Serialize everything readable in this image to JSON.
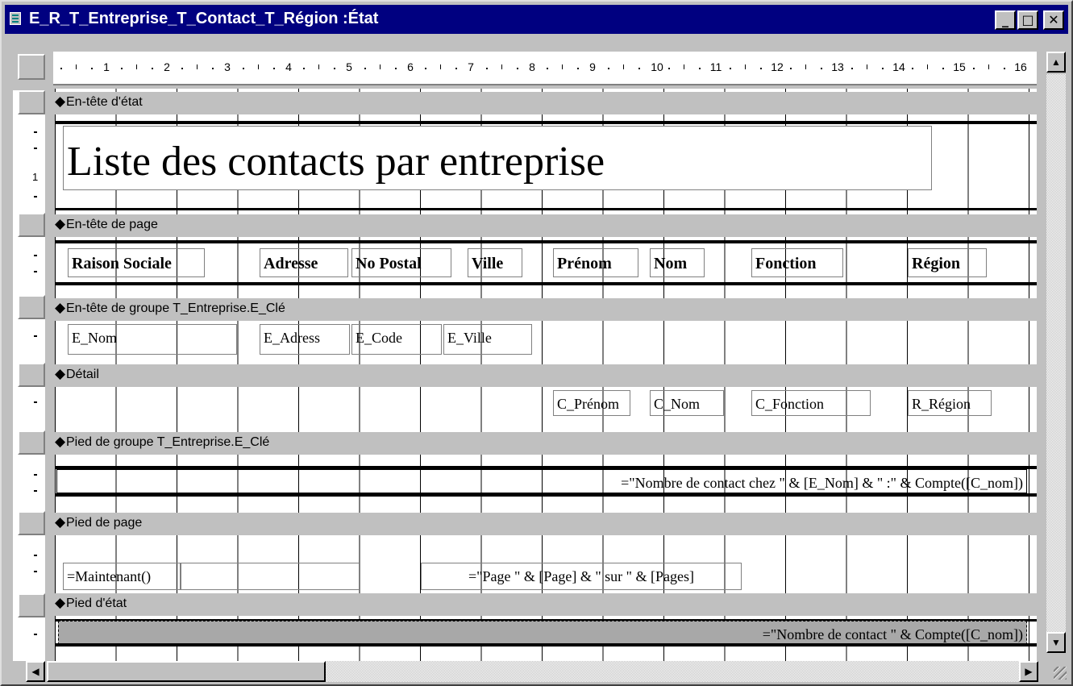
{
  "window": {
    "title": "E_R_T_Entreprise_T_Contact_T_Région :État",
    "minimize": "_",
    "maximize": "□",
    "close": "✕"
  },
  "ruler": {
    "numbers": [
      "1",
      "2",
      "3",
      "4",
      "5",
      "6",
      "7",
      "8",
      "9",
      "10",
      "11",
      "12",
      "13",
      "14",
      "15",
      "16"
    ],
    "vertical_number": "1"
  },
  "sections": {
    "report_header": "En-tête d'état",
    "page_header": "En-tête de page",
    "group_header": "En-tête de groupe T_Entreprise.E_Clé",
    "detail": "Détail",
    "group_footer": "Pied de groupe T_Entreprise.E_Clé",
    "page_footer": "Pied de page",
    "report_footer": "Pied d'état"
  },
  "report_title": "Liste des contacts par entreprise",
  "page_header_labels": {
    "raison_sociale": "Raison Sociale",
    "adresse": "Adresse",
    "no_postal": "No Postal",
    "ville": "Ville",
    "prenom": "Prénom",
    "nom": "Nom",
    "fonction": "Fonction",
    "region": "Région"
  },
  "group_fields": {
    "e_nom": "E_Nom",
    "e_adresse": "E_Adress",
    "e_code": "E_Code",
    "e_ville": "E_Ville"
  },
  "detail_fields": {
    "c_prenom": "C_Prénom",
    "c_nom": "C_Nom",
    "c_fonction": "C_Fonction",
    "r_region": "R_Région"
  },
  "group_footer_expr": "=\"Nombre de contact chez \" & [E_Nom] & \" :\" & Compte([C_nom])",
  "page_footer": {
    "now": "=Maintenant()",
    "page_expr": "=\"Page \" & [Page] & \" sur \" & [Pages]"
  },
  "report_footer_expr": "=\"Nombre de contact \" & Compte([C_nom])"
}
